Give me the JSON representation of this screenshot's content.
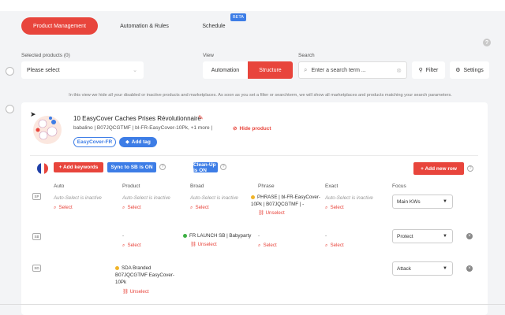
{
  "tabs": {
    "product_management": "Product Management",
    "automation_rules": "Automation & Rules",
    "schedule": "Schedule",
    "beta": "BETA"
  },
  "filters": {
    "selected_products_label": "Selected products (0)",
    "select_placeholder": "Please select",
    "view_label": "View",
    "view_automation": "Automation",
    "view_structure": "Structure",
    "search_label": "Search",
    "search_placeholder": "Enter a search term ...",
    "filter_button": "Filter",
    "settings_button": "Settings"
  },
  "info_text": "In this view we hide all your disabled or inactive products and marketplaces. As soon as you set a filter or searchterm, we will show all marketplaces and products matching your search parameters.",
  "product": {
    "title": "10 EasyCover Caches Prises Révolutionnaire",
    "meta": "babalino  |  B07JQCGTMF  |  bl-FR-EasyCover-10Pk, +1 more  |",
    "hide_label": "Hide product",
    "tag": "EasyCover-FR",
    "add_tag": "Add tag"
  },
  "actions": {
    "add_keywords": "+ Add keywords",
    "sync_sb": "Sync to SB is ON",
    "cleanup": "Clean-Up is ON",
    "add_new_row": "+ Add new row"
  },
  "columns": {
    "auto": "Auto",
    "product": "Product",
    "broad": "Broad",
    "phrase": "Phrase",
    "exact": "Exact",
    "focus": "Focus"
  },
  "rows": [
    {
      "badge": "SP",
      "auto": "Auto-Select is inactive",
      "product": "Auto-Select is inactive",
      "broad": "Auto-Select is inactive",
      "phrase_line1": "PHRASE | bl-FR-EasyCover-",
      "phrase_line2": "10Pk | B07JQCGTMF | -",
      "exact": "Auto-Select is inactive",
      "select": "Select",
      "unselect": "Unselect",
      "focus": "Main KWs"
    },
    {
      "badge": "SB",
      "dash": "-",
      "broad": "FR LAUNCH SB | Babyparty",
      "select": "Select",
      "unselect": "Unselect",
      "focus": "Protect"
    },
    {
      "badge": "SD",
      "product_line1": "SDA Branded",
      "product_line2": "B07JQCGTMF EasyCover-",
      "product_line3": "10Pk",
      "unselect": "Unselect",
      "focus": "Attack"
    }
  ],
  "colors": {
    "accent_red": "#e8453c",
    "accent_blue": "#3d7de6",
    "dot_orange": "#f0b429",
    "dot_green": "#3cb043"
  }
}
